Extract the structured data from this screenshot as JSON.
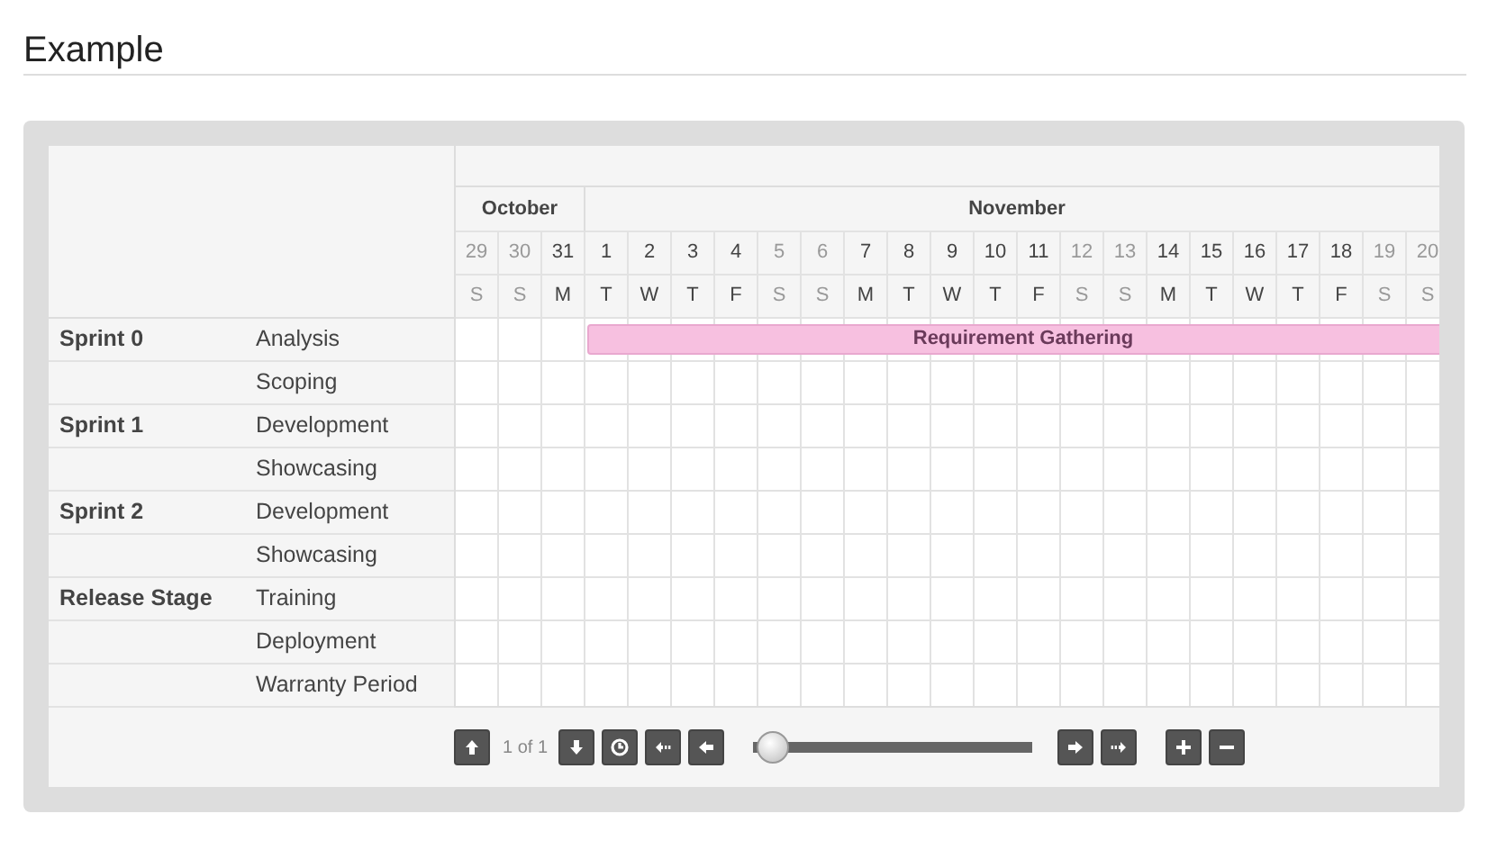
{
  "title": "Example",
  "months": [
    {
      "label": "October",
      "days": [
        {
          "date": "29",
          "dow": "S",
          "weekend": true
        },
        {
          "date": "30",
          "dow": "S",
          "weekend": true
        },
        {
          "date": "31",
          "dow": "M",
          "weekend": false
        }
      ]
    },
    {
      "label": "November",
      "days": [
        {
          "date": "1",
          "dow": "T",
          "weekend": false
        },
        {
          "date": "2",
          "dow": "W",
          "weekend": false
        },
        {
          "date": "3",
          "dow": "T",
          "weekend": false
        },
        {
          "date": "4",
          "dow": "F",
          "weekend": false
        },
        {
          "date": "5",
          "dow": "S",
          "weekend": true
        },
        {
          "date": "6",
          "dow": "S",
          "weekend": true
        },
        {
          "date": "7",
          "dow": "M",
          "weekend": false
        },
        {
          "date": "8",
          "dow": "T",
          "weekend": false
        },
        {
          "date": "9",
          "dow": "W",
          "weekend": false
        },
        {
          "date": "10",
          "dow": "T",
          "weekend": false
        },
        {
          "date": "11",
          "dow": "F",
          "weekend": false
        },
        {
          "date": "12",
          "dow": "S",
          "weekend": true
        },
        {
          "date": "13",
          "dow": "S",
          "weekend": true
        },
        {
          "date": "14",
          "dow": "M",
          "weekend": false
        },
        {
          "date": "15",
          "dow": "T",
          "weekend": false
        },
        {
          "date": "16",
          "dow": "W",
          "weekend": false
        },
        {
          "date": "17",
          "dow": "T",
          "weekend": false
        },
        {
          "date": "18",
          "dow": "F",
          "weekend": false
        },
        {
          "date": "19",
          "dow": "S",
          "weekend": true
        },
        {
          "date": "20",
          "dow": "S",
          "weekend": true
        }
      ]
    }
  ],
  "rows": [
    {
      "group": "Sprint 0",
      "name": "Analysis",
      "timeline": [
        {
          "kind": "gap"
        },
        {
          "kind": "gap"
        },
        {
          "kind": "gap"
        },
        {
          "kind": "bar",
          "label": "Requirement Gathering",
          "color": "#f7c0e0"
        }
      ]
    },
    {
      "name": "Scoping"
    },
    {
      "group": "Sprint 1",
      "name": "Development"
    },
    {
      "name": "Showcasing"
    },
    {
      "group": "Sprint 2",
      "name": "Development"
    },
    {
      "name": "Showcasing"
    },
    {
      "group": "Release Stage",
      "name": "Training"
    },
    {
      "name": "Deployment"
    },
    {
      "name": "Warranty Period"
    }
  ],
  "footer": {
    "page": "1 of 1",
    "zoom": {
      "level": 0.03
    }
  }
}
